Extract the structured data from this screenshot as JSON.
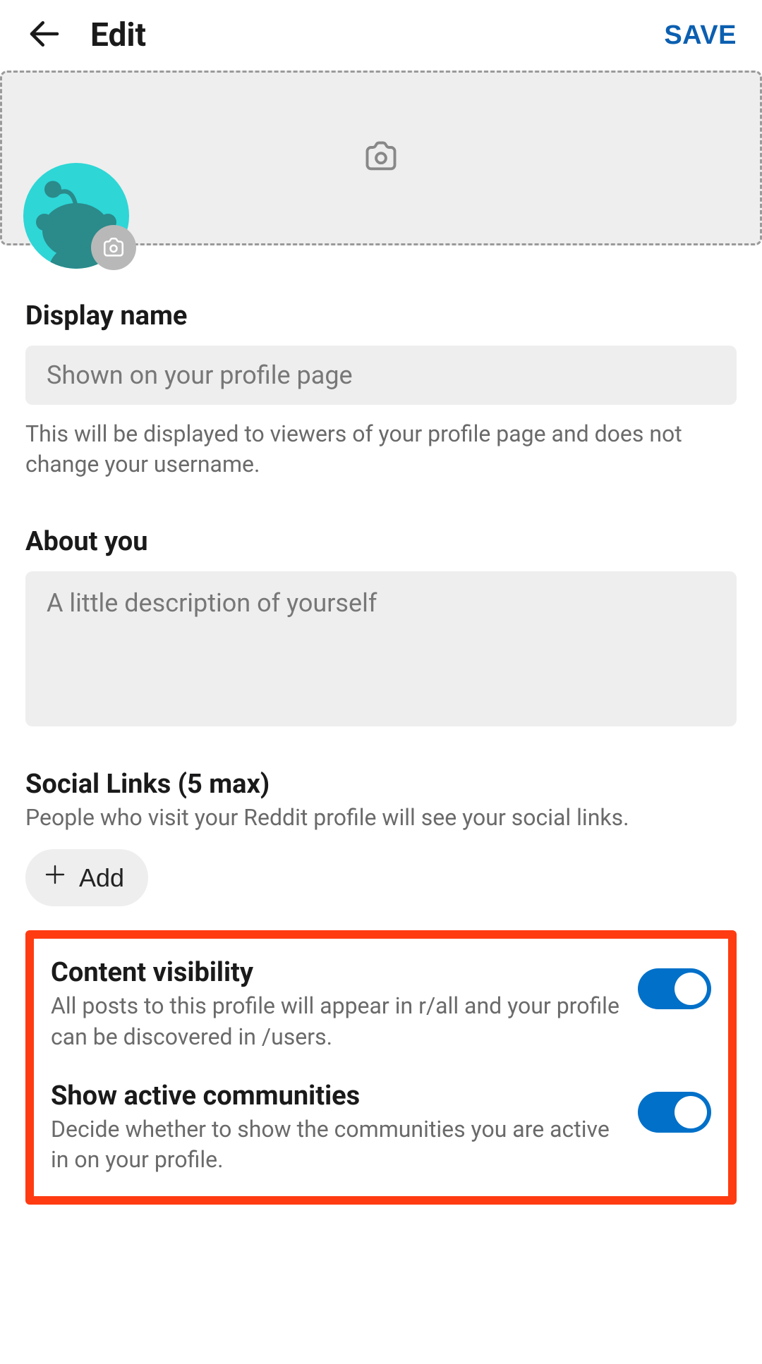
{
  "header": {
    "title": "Edit",
    "save_label": "SAVE"
  },
  "display_name": {
    "label": "Display name",
    "placeholder": "Shown on your profile page",
    "value": "",
    "helper": "This will be displayed to viewers of your profile page and does not change your username."
  },
  "about": {
    "label": "About you",
    "placeholder": "A little description of yourself",
    "value": ""
  },
  "social_links": {
    "label": "Social Links (5 max)",
    "desc": "People who visit your Reddit profile will see your social links.",
    "add_label": "Add"
  },
  "toggles": {
    "content_visibility": {
      "title": "Content visibility",
      "desc": "All posts to this profile will appear in r/all and your profile can be discovered in /users.",
      "on": true
    },
    "show_active": {
      "title": "Show active communities",
      "desc": "Decide whether to show the communities you are active in on your profile.",
      "on": true
    }
  },
  "colors": {
    "accent": "#0070c9",
    "highlight_border": "#ff3b12",
    "avatar_bg": "#2ed6d6"
  }
}
